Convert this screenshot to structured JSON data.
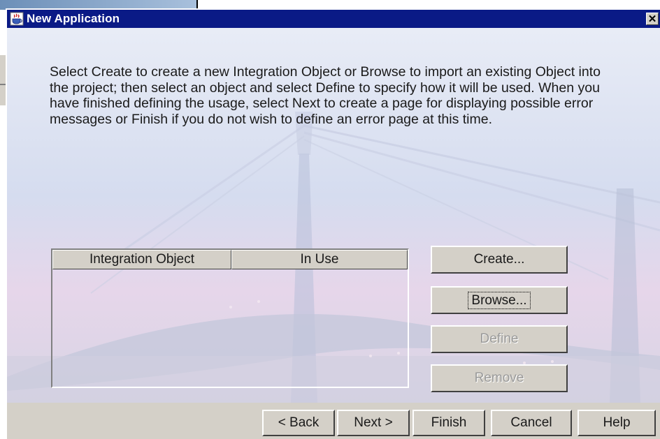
{
  "dialog": {
    "title": "New Application",
    "title_icon": "java-cup-icon",
    "close_icon": "close-icon",
    "close_glyph": "✕"
  },
  "instructions": "Select Create to create a new Integration Object or Browse to import an existing Object into the project; then select an object and select Define to specify how it will be used. When you have finished defining the usage, select Next to create a page for displaying possible error messages or Finish if you do not wish to define an error page at this time.",
  "table": {
    "columns": [
      "Integration Object",
      "In Use"
    ],
    "rows": []
  },
  "side_buttons": {
    "create": "Create...",
    "browse": "Browse...",
    "define": "Define",
    "remove": "Remove"
  },
  "nav_buttons": {
    "back": "< Back",
    "next": "Next >",
    "finish": "Finish",
    "cancel": "Cancel",
    "help": "Help"
  },
  "colors": {
    "titlebar": "#0a1a86",
    "panel": "#d4d0c8",
    "disabled_text": "#9a9a9a"
  }
}
